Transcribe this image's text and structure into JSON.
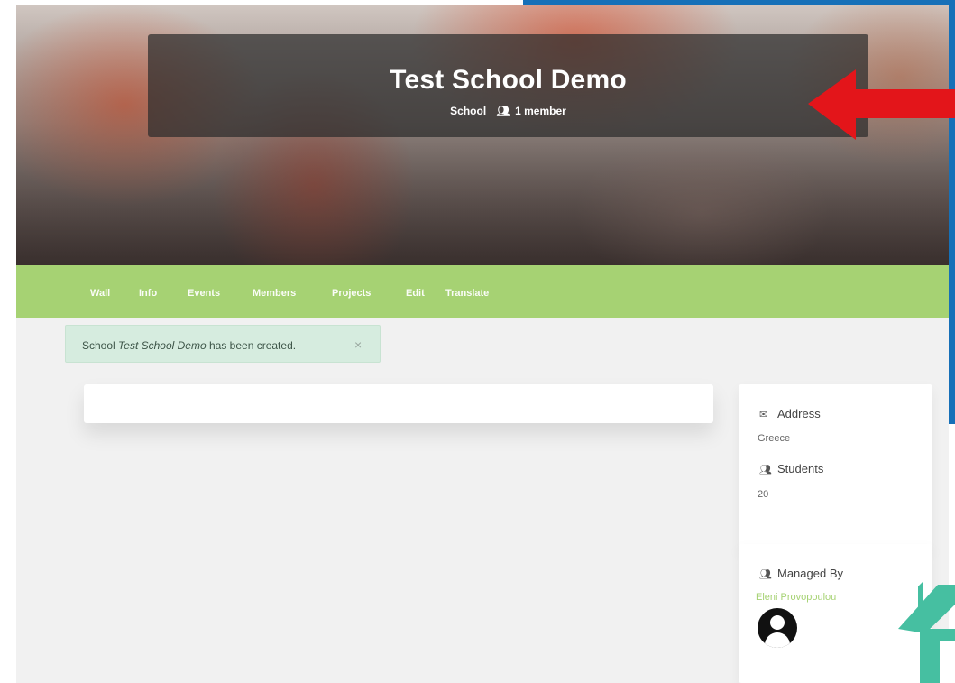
{
  "hero": {
    "title": "Test School Demo",
    "type_label": "School",
    "members_label": "1 member"
  },
  "nav": {
    "items": [
      "Wall",
      "Info",
      "Events",
      "Members",
      "Projects",
      "Edit",
      "Translate"
    ]
  },
  "alert": {
    "prefix": "School",
    "name": "Test School Demo",
    "suffix": "has been created.",
    "close_glyph": "×"
  },
  "sidebar": {
    "address_label": "Address",
    "address_value": "Greece",
    "students_label": "Students",
    "students_value": "20",
    "managed_by_label": "Managed By",
    "manager_name": "Eleni Provopoulou"
  },
  "icons": [
    "envelope-icon",
    "users-icon",
    "manager-icon",
    "close-icon",
    "avatar-icon"
  ],
  "colors": {
    "nav_green": "#a6d273",
    "link_green": "#a6d273",
    "alert_bg": "#d6ecdf",
    "frame_blue": "#1670b8",
    "arrow_red": "#e3151a",
    "house_teal": "#46bfa1"
  }
}
